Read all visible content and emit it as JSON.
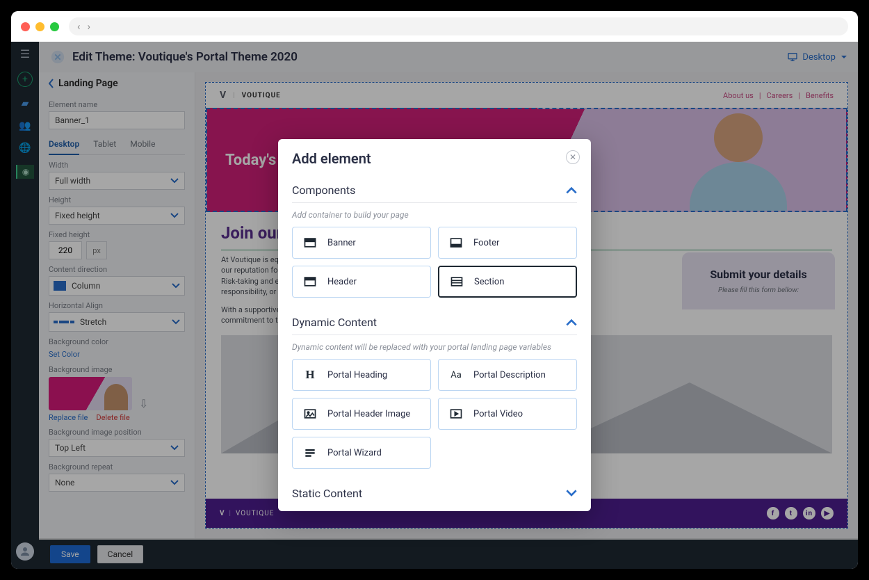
{
  "header": {
    "title": "Edit Theme: Voutique's Portal Theme 2020",
    "viewport": "Desktop"
  },
  "sidebar": {
    "title": "Landing Page",
    "elementNameLabel": "Element name",
    "elementName": "Banner_1",
    "tabs": [
      "Desktop",
      "Tablet",
      "Mobile"
    ],
    "activeTab": 0,
    "widthLabel": "Width",
    "width": "Full width",
    "heightLabel": "Height",
    "height": "Fixed height",
    "fixedHeightLabel": "Fixed height",
    "fixedHeight": "220",
    "unit": "px",
    "directionLabel": "Content direction",
    "direction": "Column",
    "hAlignLabel": "Horizontal Align",
    "hAlign": "Stretch",
    "bgColorLabel": "Background color",
    "setColor": "Set Color",
    "bgImageLabel": "Background image",
    "replaceFile": "Replace file",
    "deleteFile": "Delete file",
    "bgPosLabel": "Background image position",
    "bgPos": "Top Left",
    "bgRepeatLabel": "Background repeat",
    "bgRepeat": "None"
  },
  "footer": {
    "save": "Save",
    "cancel": "Cancel"
  },
  "canvas": {
    "brand": "VOUTIQUE",
    "nav": [
      "About us",
      "Careers",
      "Benefits"
    ],
    "heroTitle": "Today's Talen",
    "joinTitle": "Join our Tale",
    "para1": "At Voutique is equally con\nour reputation for fostering\nRisk-taking and experimen\nresponsibility, or product c",
    "para2": "With a supportive work en\ncommitment to the comp",
    "submitTitle": "Submit your details",
    "submitHint": "Please fill this form bellow:",
    "footerBrand": "VOUTIQUE"
  },
  "modal": {
    "title": "Add element",
    "sections": {
      "components": {
        "title": "Components",
        "hint": "Add container to build your page",
        "items": [
          "Banner",
          "Footer",
          "Header",
          "Section"
        ],
        "selected": 3
      },
      "dynamic": {
        "title": "Dynamic Content",
        "hint": "Dynamic content will be replaced with your portal landing page variables",
        "items": [
          "Portal Heading",
          "Portal Description",
          "Portal Header Image",
          "Portal Video",
          "Portal Wizard"
        ]
      },
      "static": {
        "title": "Static Content"
      }
    }
  }
}
